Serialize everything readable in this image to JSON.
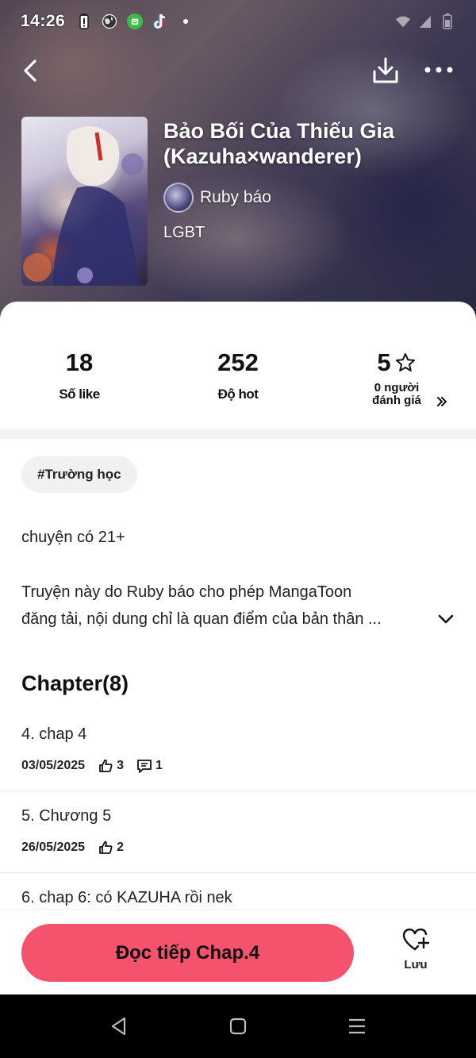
{
  "status_bar": {
    "time": "14:26"
  },
  "nav": {
    "back_icon": "chevron-left-icon",
    "download_icon": "download-icon",
    "more_icon": "more-dots-icon"
  },
  "book": {
    "title": "Bảo Bối Của Thiếu Gia (Kazuha×wanderer)",
    "author": "Ruby báo",
    "genre": "LGBT"
  },
  "stats": {
    "likes_value": "18",
    "likes_label": "Số like",
    "hot_value": "252",
    "hot_label": "Độ hot",
    "rating_value": "5",
    "rating_label_line1": "0 người",
    "rating_label_line2": "đánh giá"
  },
  "tags": [
    "#Trường học"
  ],
  "description": {
    "line1": "chuyện có 21+",
    "line2": "Truyện này do Ruby báo cho phép MangaToon",
    "line3": "đăng tải, nội dung chỉ là quan điểm của bản thân ..."
  },
  "chapters": {
    "heading": "Chapter(8)",
    "items": [
      {
        "title": "4. chap 4",
        "date": "03/05/2025",
        "likes": "3",
        "comments": "1"
      },
      {
        "title": "5. Chương 5",
        "date": "26/05/2025",
        "likes": "2"
      },
      {
        "title": "6. chap 6: có KAZUHA rồi nek"
      }
    ]
  },
  "bottom": {
    "read_label": "Đọc tiếp Chap.4",
    "save_label": "Lưu"
  },
  "colors": {
    "accent": "#f5526e",
    "divider": "#f3f3f3"
  }
}
